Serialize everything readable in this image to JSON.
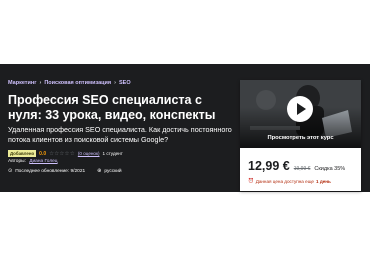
{
  "breadcrumbs": [
    "Маркетинг",
    "Поисковая оптимизация",
    "SEO"
  ],
  "course": {
    "title": "Профессия SEO специалиста с нуля: 33 урока, видео, конспекты",
    "subtitle": "Удаленная профессия SEO специалиста. Как достичь постоянного потока клиентов из поисковой системы Google?",
    "badge": "Добавлено",
    "rating": "0.0",
    "rating_stars": 0,
    "ratings_count": "(0 оценок)",
    "students": "1 студент",
    "author_label": "Авторы:",
    "author_name": "Диана Голец",
    "updated": "Последнее обновление: 9/2021",
    "language": "русский"
  },
  "card": {
    "preview_label": "Просмотреть этот курс",
    "price": "12,99 €",
    "old_price": "19,99 €",
    "discount": "Скидка 35%",
    "timer_prefix": "Данная цена доступна еще",
    "timer_days": "1 день"
  },
  "colors": {
    "hero_bg": "#1c1d1f",
    "breadcrumb": "#cec0fc",
    "rating": "#f69c08",
    "badge_bg": "#eceb98",
    "alert": "#b32d0f"
  },
  "icons": {
    "breadcrumb_separator": "chevron-right-icon",
    "updated": "alert-icon",
    "language": "globe-icon",
    "timer": "alarm-clock-icon",
    "preview": "play-icon"
  }
}
